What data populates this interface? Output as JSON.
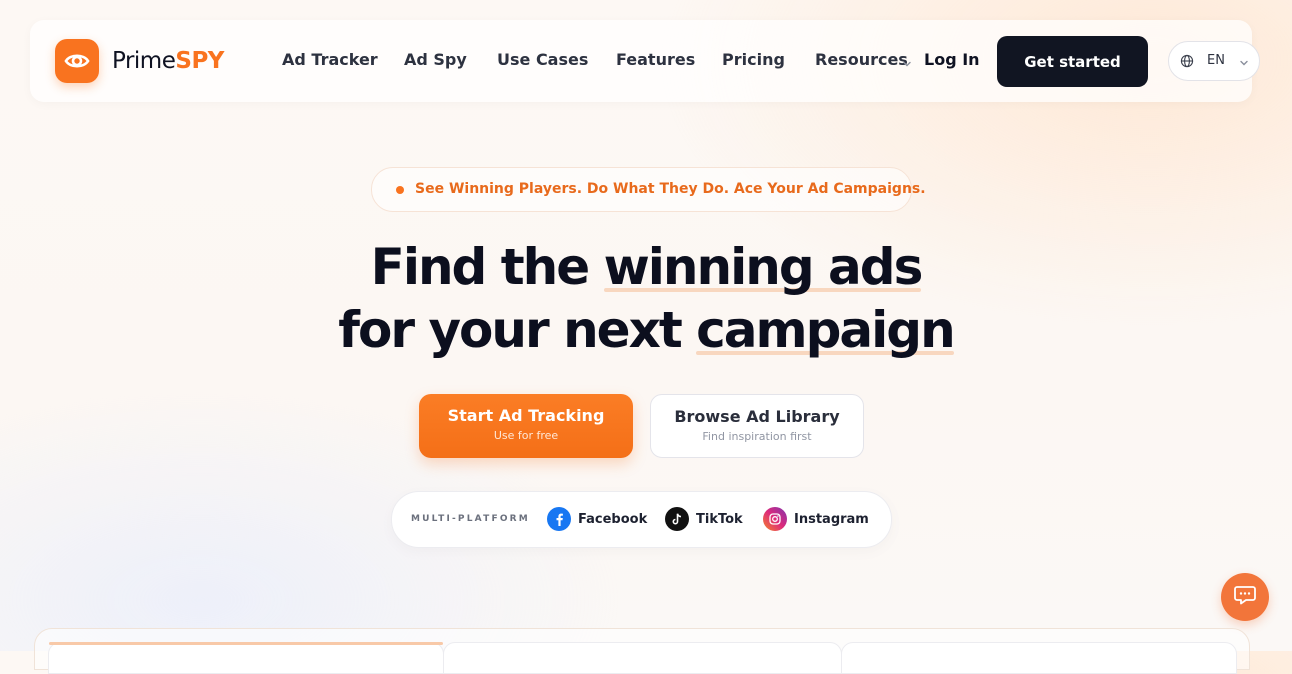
{
  "brand": {
    "name_part1": "Prime",
    "name_part2": "SPY",
    "accent": "#f9731f",
    "icon": "eye-logo-icon"
  },
  "nav": {
    "items": [
      {
        "label": "Ad Tracker"
      },
      {
        "label": "Ad Spy"
      },
      {
        "label": "Use Cases"
      },
      {
        "label": "Features"
      },
      {
        "label": "Pricing"
      },
      {
        "label": "Resources",
        "has_dropdown": true
      }
    ],
    "login": "Log In",
    "cta": "Get started",
    "language": "EN"
  },
  "hero": {
    "tagline": "See Winning Players. Do What They Do. Ace Your Ad Campaigns.",
    "line1_plain": "Find the ",
    "line1_highlight": "winning ads",
    "line2_plain": "for your next ",
    "line2_highlight": "campaign",
    "primary_button": {
      "label": "Start Ad Tracking",
      "sub": "Use for free"
    },
    "secondary_button": {
      "label": "Browse Ad Library",
      "sub": "Find inspiration first"
    }
  },
  "platforms": {
    "label": "MULTI-PLATFORM",
    "items": [
      {
        "name": "Facebook",
        "icon": "facebook-icon",
        "color": "#1877f2"
      },
      {
        "name": "TikTok",
        "icon": "tiktok-icon",
        "color": "#111111"
      },
      {
        "name": "Instagram",
        "icon": "instagram-icon",
        "color": "#d6249f"
      }
    ]
  },
  "chat": {
    "icon": "chat-icon",
    "color": "#f2753a"
  }
}
